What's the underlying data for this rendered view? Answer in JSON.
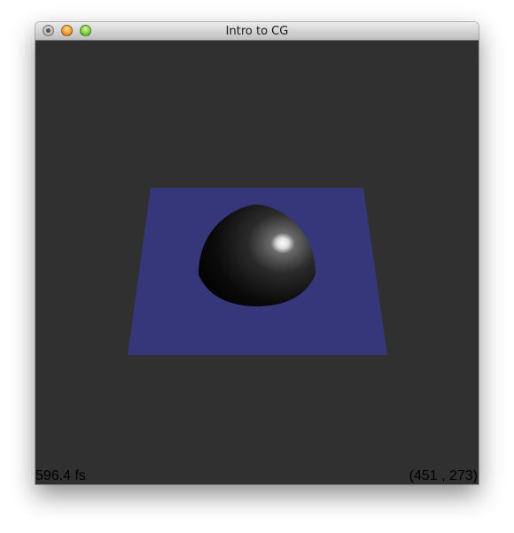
{
  "window": {
    "title": "Intro to CG"
  },
  "viewport": {
    "fps_text": "596.4 fs",
    "cursor_coords_text": "(451 , 273)"
  },
  "scene": {
    "background_color": "#303030",
    "plane_color": "#36367a",
    "sphere_color": "#000000"
  }
}
